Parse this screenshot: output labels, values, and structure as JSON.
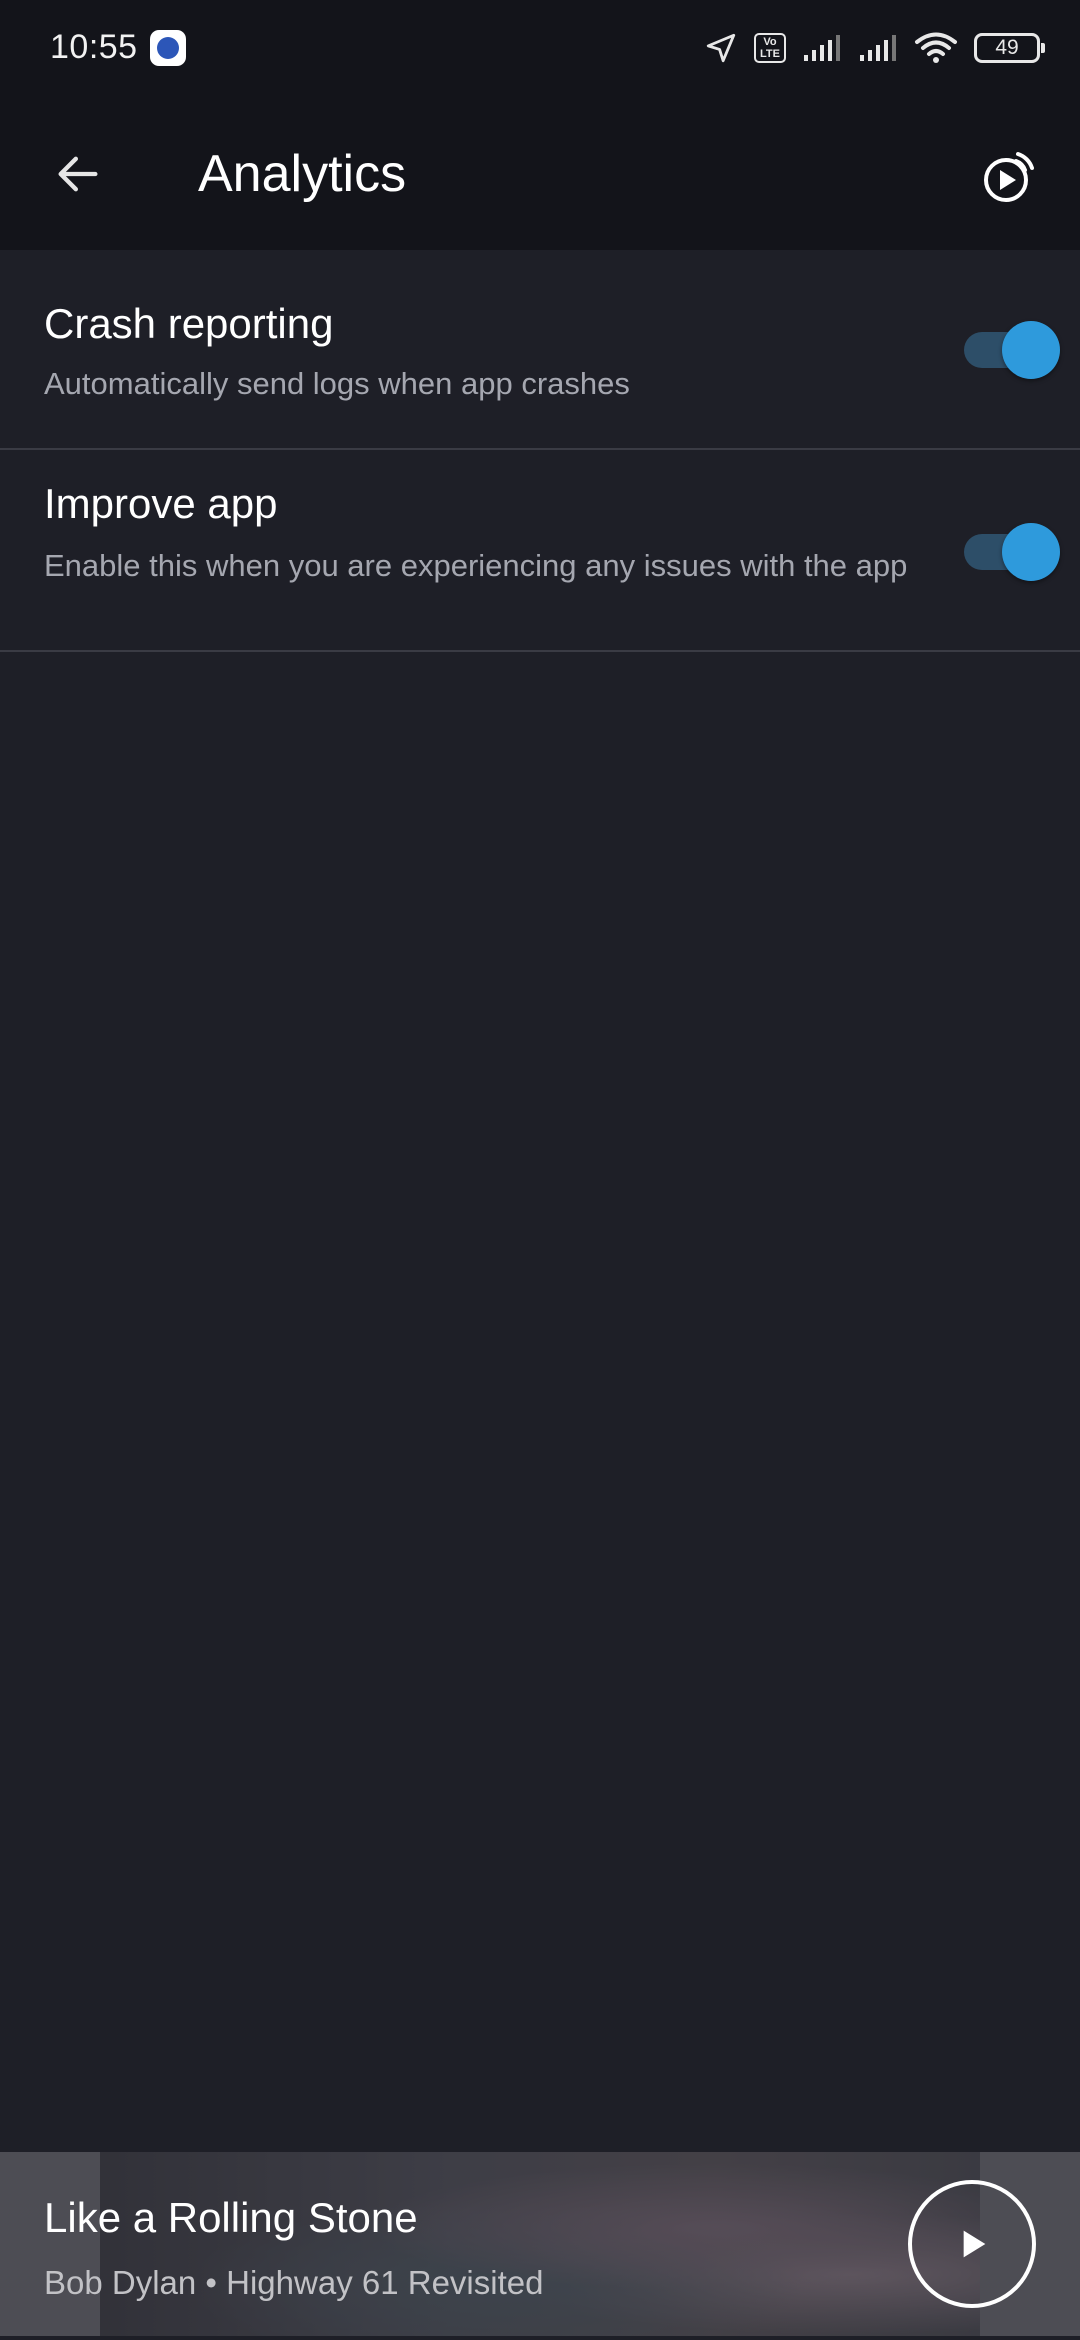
{
  "status_bar": {
    "time": "10:55",
    "battery_level": "49",
    "volte_label": "Vo\nLTE",
    "icons": [
      "app-notification-icon",
      "location-icon",
      "volte-icon",
      "signal-icon",
      "signal-icon",
      "wifi-icon",
      "battery-icon"
    ]
  },
  "app_bar": {
    "title": "Analytics",
    "back_icon": "arrow-left-icon",
    "cast_icon": "cast-play-icon"
  },
  "settings": [
    {
      "title": "Crash reporting",
      "description": "Automatically send logs when app crashes",
      "enabled": true
    },
    {
      "title": "Improve app",
      "description": "Enable this when you are experiencing any issues with the app",
      "enabled": true
    }
  ],
  "mini_player": {
    "track_title": "Like a Rolling Stone",
    "track_subtitle": "Bob Dylan • Highway 61 Revisited",
    "play_icon": "play-icon"
  },
  "colors": {
    "background": "#1e1f27",
    "app_bar": "#13141a",
    "toggle_thumb": "#2e9adc",
    "toggle_track": "#2d4e68",
    "divider": "#3a3b44"
  }
}
